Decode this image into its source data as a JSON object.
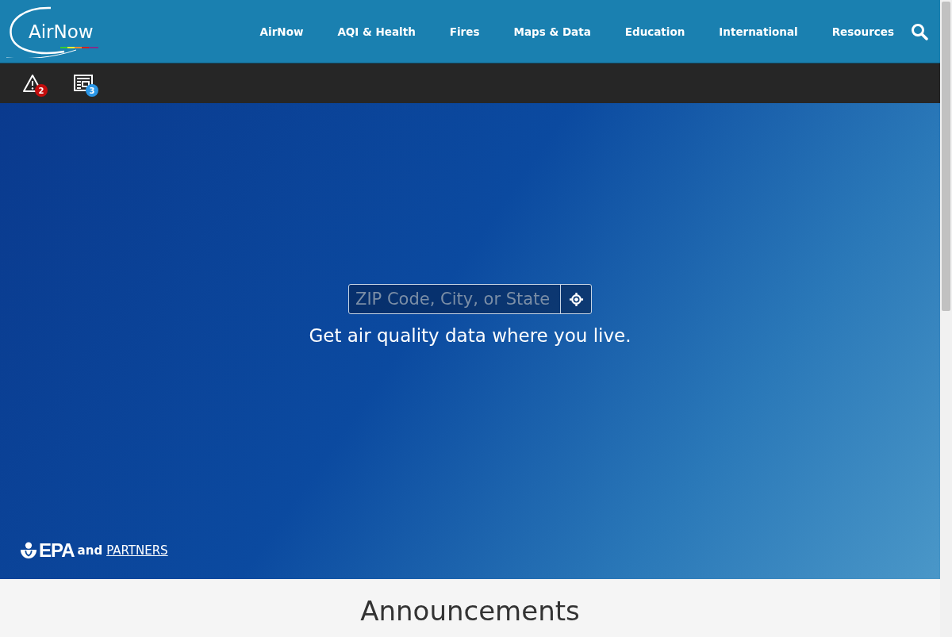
{
  "header": {
    "logo_text": "AirNow",
    "nav": [
      "AirNow",
      "AQI & Health",
      "Fires",
      "Maps & Data",
      "Education",
      "International",
      "Resources"
    ]
  },
  "toolbar": {
    "alerts_count": "2",
    "news_count": "3"
  },
  "hero": {
    "search": {
      "placeholder": "ZIP Code, City, or State"
    },
    "tagline": "Get air quality data where you live.",
    "credit": {
      "logo_text": "EPA",
      "and": "and",
      "link": "PARTNERS"
    }
  },
  "announcements": {
    "title": "Announcements"
  }
}
